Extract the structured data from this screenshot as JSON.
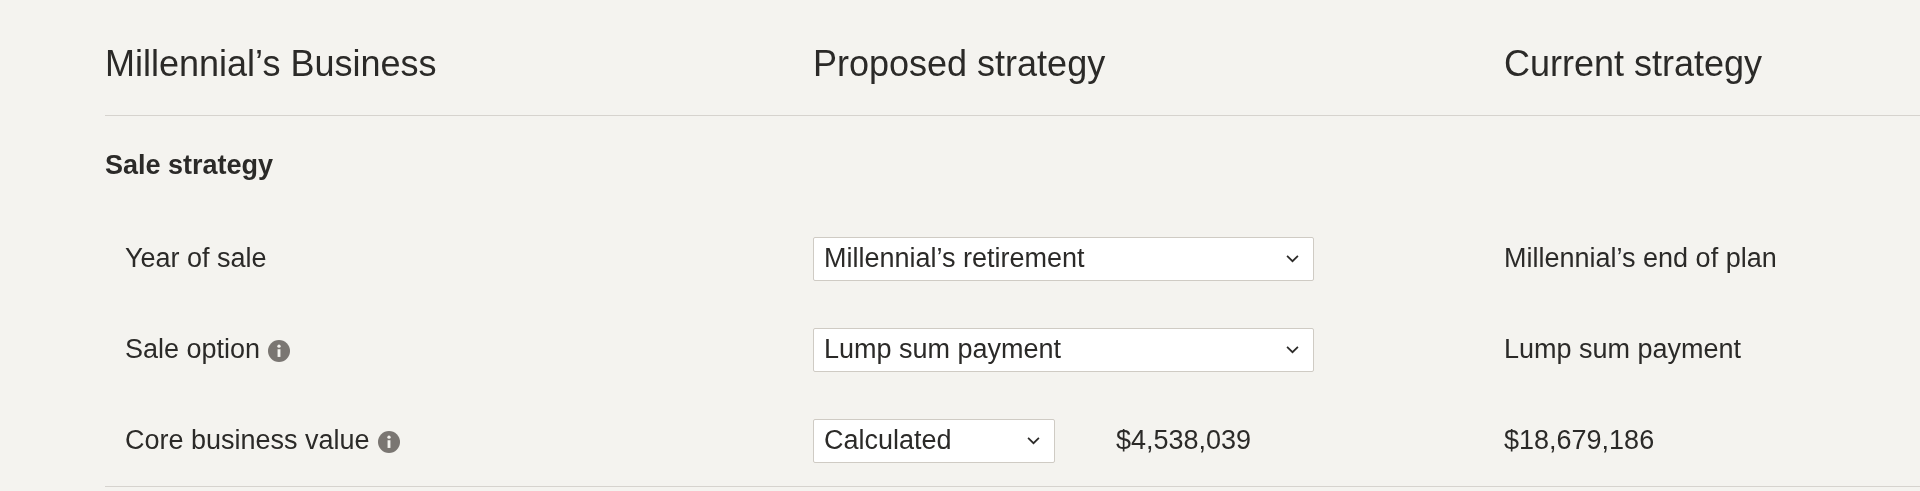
{
  "headers": [
    "Millennial’s Business",
    "Proposed strategy",
    "Current strategy"
  ],
  "section": {
    "title": "Sale strategy",
    "rows": [
      {
        "label": "Year of sale",
        "info": false,
        "proposed": "Millennial’s retirement",
        "current": "Millennial’s end of plan"
      },
      {
        "label": "Sale option",
        "info": true,
        "proposed": "Lump sum payment",
        "current": "Lump sum payment"
      },
      {
        "label": "Core business value",
        "info": true,
        "proposed": "Calculated",
        "amount": "$4,538,039",
        "current": "$18,679,186"
      }
    ]
  }
}
